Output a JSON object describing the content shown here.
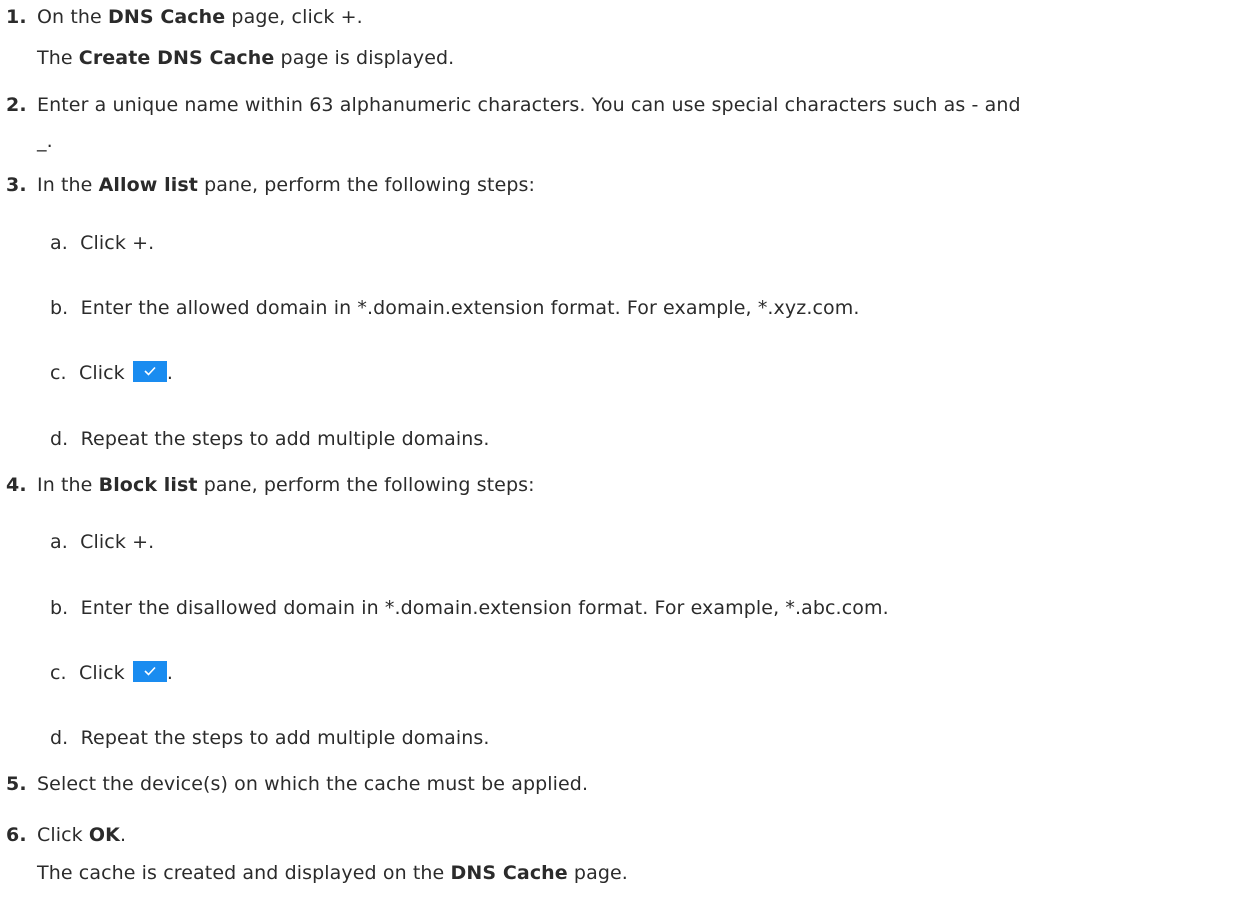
{
  "steps": [
    {
      "number": "1.",
      "before": "On the ",
      "bold": "DNS Cache",
      "after": " page, click +.",
      "result_before": "The ",
      "result_bold": "Create DNS Cache",
      "result_after": " page is displayed."
    },
    {
      "number": "2.",
      "line1": "Enter a unique name within 63 alphanumeric characters. You can use special characters such as - and",
      "line2": "_."
    },
    {
      "number": "3.",
      "before": "In the ",
      "bold": "Allow list",
      "after": " pane, perform the following steps:",
      "substeps": [
        {
          "letter": "a.",
          "text": "Click +."
        },
        {
          "letter": "b.",
          "text": "Enter the allowed domain in *.domain.extension format. For example, *.xyz.com."
        },
        {
          "letter": "c.",
          "text": "Click",
          "end": "."
        },
        {
          "letter": "d.",
          "text": "Repeat the steps to add multiple domains."
        }
      ]
    },
    {
      "number": "4.",
      "before": "In the ",
      "bold": "Block list",
      "after": " pane, perform the following steps:",
      "substeps": [
        {
          "letter": "a.",
          "text": "Click +."
        },
        {
          "letter": "b.",
          "text": "Enter the disallowed domain in *.domain.extension format. For example, *.abc.com."
        },
        {
          "letter": "c.",
          "text": "Click",
          "end": "."
        },
        {
          "letter": "d.",
          "text": "Repeat the steps to add multiple domains."
        }
      ]
    },
    {
      "number": "5.",
      "text": "Select the device(s) on which the cache must be applied."
    },
    {
      "number": "6.",
      "before": "Click ",
      "bold": "OK",
      "after": ".",
      "result_before": "The cache is created and displayed on the ",
      "result_bold": "DNS Cache",
      "result_after": " page."
    }
  ],
  "icons": {
    "confirm": "checkmark-icon",
    "confirm_color": "#1a8cf0"
  }
}
